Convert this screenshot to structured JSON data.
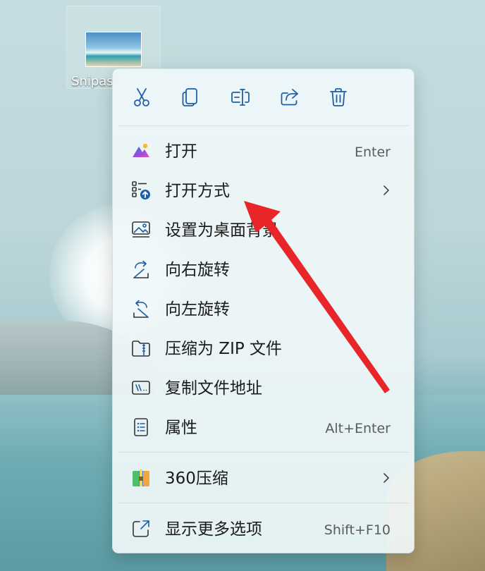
{
  "desktop": {
    "icon_label": "Snipaste"
  },
  "toolbar": {
    "buttons": [
      {
        "name": "cut",
        "icon": "scissors-icon"
      },
      {
        "name": "copy",
        "icon": "copy-icon"
      },
      {
        "name": "rename",
        "icon": "rename-icon"
      },
      {
        "name": "share",
        "icon": "share-icon"
      },
      {
        "name": "delete",
        "icon": "trash-icon"
      }
    ]
  },
  "menu": {
    "items": [
      {
        "label": "打开",
        "shortcut": "Enter",
        "icon": "photos-app-icon"
      },
      {
        "label": "打开方式",
        "shortcut": "",
        "icon": "open-with-icon",
        "submenu": true
      },
      {
        "label": "设置为桌面背景",
        "shortcut": "",
        "icon": "wallpaper-icon"
      },
      {
        "label": "向右旋转",
        "shortcut": "",
        "icon": "rotate-right-icon"
      },
      {
        "label": "向左旋转",
        "shortcut": "",
        "icon": "rotate-left-icon"
      },
      {
        "label": "压缩为 ZIP 文件",
        "shortcut": "",
        "icon": "zip-folder-icon"
      },
      {
        "label": "复制文件地址",
        "shortcut": "",
        "icon": "copy-path-icon"
      },
      {
        "label": "属性",
        "shortcut": "Alt+Enter",
        "icon": "properties-icon"
      }
    ],
    "extra_items": [
      {
        "label": "360压缩",
        "shortcut": "",
        "icon": "360zip-icon",
        "submenu": true
      }
    ],
    "footer_items": [
      {
        "label": "显示更多选项",
        "shortcut": "Shift+F10",
        "icon": "more-options-icon"
      }
    ]
  },
  "colors": {
    "accent_blue": "#1f5fa8",
    "arrow_red": "#e8262a",
    "menu_bg": "#f0f7f8"
  }
}
